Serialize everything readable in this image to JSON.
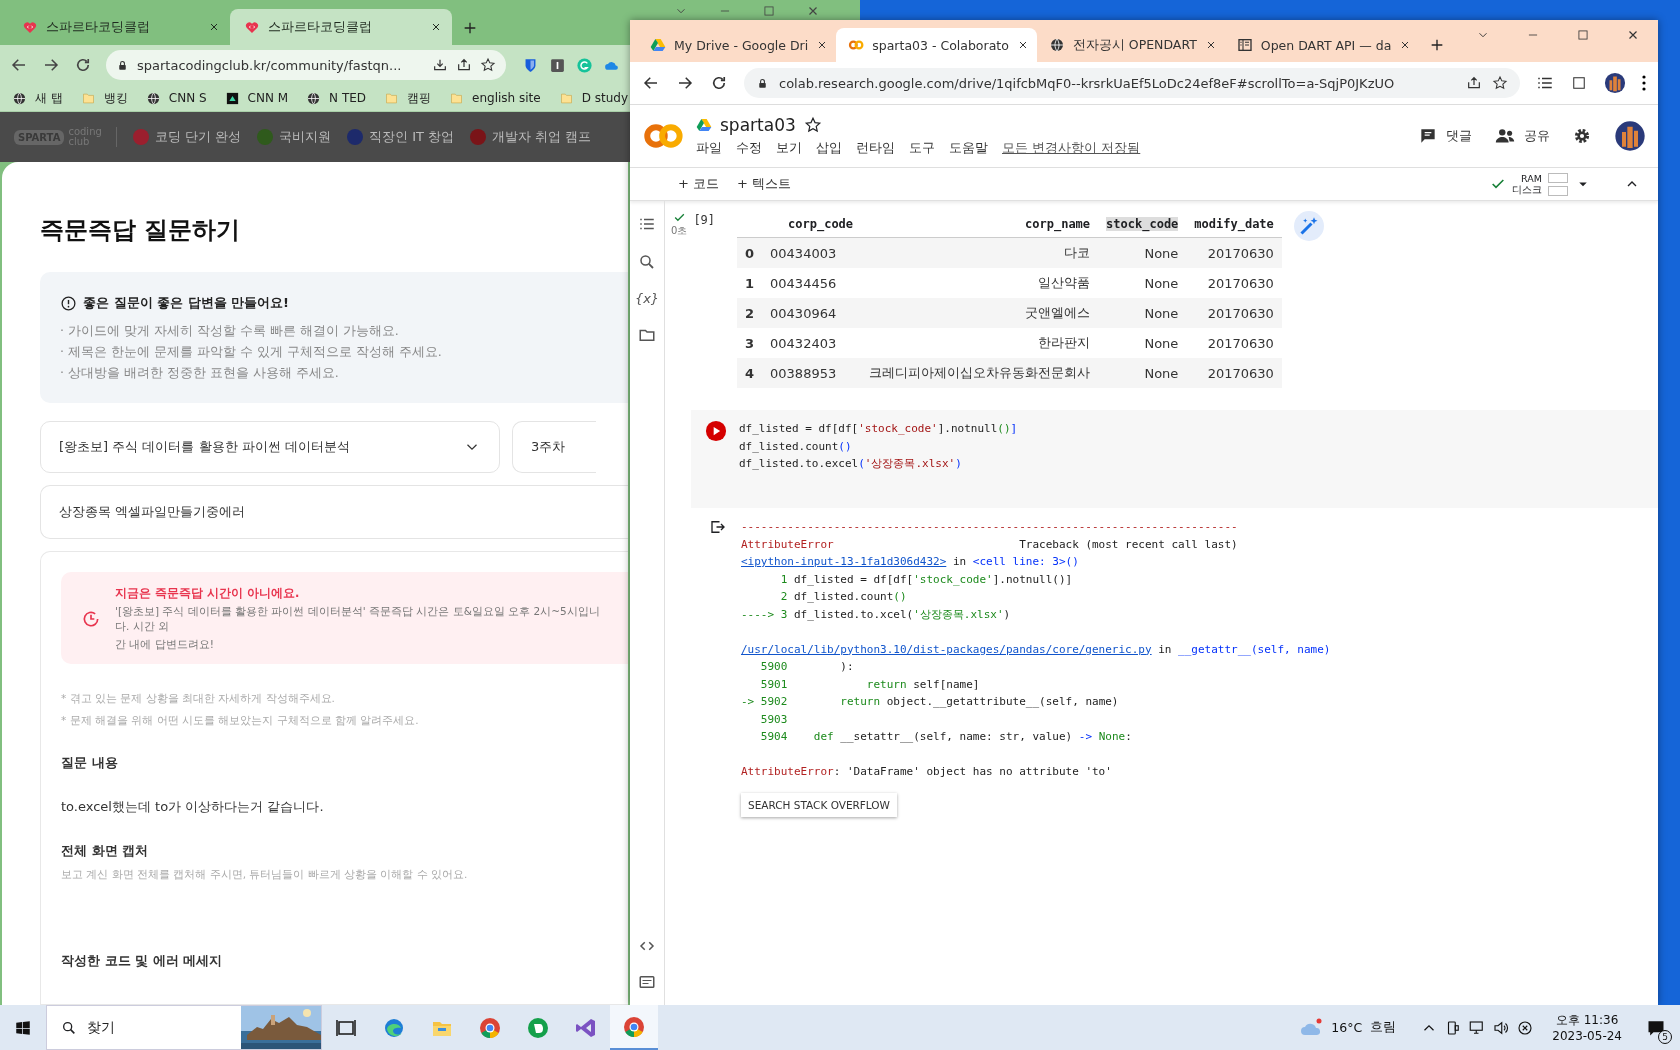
{
  "left_window": {
    "tabs": [
      {
        "title": "스파르타코딩클럽",
        "selected": false
      },
      {
        "title": "스파르타코딩클럽",
        "selected": true
      }
    ],
    "address": "spartacodingclub.kr/community/fastqn...",
    "bookmarks": [
      {
        "label": "새 탭",
        "kind": "globe"
      },
      {
        "label": "뱅킹",
        "kind": "folder"
      },
      {
        "label": "CNN S",
        "kind": "globe"
      },
      {
        "label": "CNN M",
        "kind": "app"
      },
      {
        "label": "N TED",
        "kind": "globe"
      },
      {
        "label": "캠핑",
        "kind": "folder"
      },
      {
        "label": "english site",
        "kind": "folder"
      },
      {
        "label": "D study",
        "kind": "folder"
      }
    ],
    "site_nav": {
      "logo_mark": "SPARTA",
      "logo_text": [
        "coding",
        "club"
      ],
      "items": [
        {
          "label": "코딩 단기 완성",
          "color": "#9b1f2e"
        },
        {
          "label": "국비지원",
          "color": "#2f5a1c"
        },
        {
          "label": "직장인 IT 창업",
          "color": "#1d2a6b"
        },
        {
          "label": "개발자 취업 캠프",
          "color": "#7a1418"
        }
      ]
    },
    "page": {
      "title": "즉문즉답 질문하기",
      "guide": {
        "heading": "좋은 질문이 좋은 답변을 만들어요!",
        "lines": [
          "· 가이드에 맞게 자세히 작성할 수록 빠른 해결이 가능해요.",
          "· 제목은 한눈에 문제를 파악할 수 있게 구체적으로 작성해 주세요.",
          "· 상대방을 배려한 정중한 표현을 사용해 주세요."
        ]
      },
      "course_select": "[왕초보] 주식 데이터를 활용한 파이썬 데이터분석",
      "week_select": "3주차",
      "title_field": "상장종목 엑셀파일만들기중에러",
      "notice": {
        "heading": "지금은 즉문즉답 시간이 아니에요.",
        "lines": [
          "'[왕초보] 주식 데이터를 활용한 파이썬 데이터분석' 즉문즉답 시간은 토&일요일 오후 2시~5시입니다. 시간 외",
          "간 내에 답변드려요!"
        ]
      },
      "hints": [
        "* 겪고 있는 문제 상황을 최대한 자세하게 작성해주세요.",
        "* 문제 해결을 위해 어떤 시도를 해보았는지 구체적으로 함께 알려주세요."
      ],
      "sections": [
        {
          "label": "질문 내용",
          "text": "to.excel했는데 to가 이상하다는거 같습니다."
        },
        {
          "label": "전체 화면 캡처",
          "hint": "보고 계신 화면 전체를 캡처해 주시면, 튜터님들이 빠르게 상황을 이해할 수 있어요."
        },
        {
          "label": "작성한 코드 및 에러 메세지"
        }
      ]
    }
  },
  "right_window": {
    "tabs": [
      {
        "title": "My Drive - Google Dri",
        "selected": false,
        "kind": "drive"
      },
      {
        "title": "sparta03 - Colaborato",
        "selected": true,
        "kind": "colab"
      },
      {
        "title": "전자공시 OPENDART",
        "selected": false,
        "kind": "globe"
      },
      {
        "title": "Open DART API — da",
        "selected": false,
        "kind": "book"
      }
    ],
    "address": "colab.research.google.com/drive/1qifcbMqF0--krsrkUaEf5LoDc24ef8eF#scrollTo=a-SqjP0JKzUO",
    "notebook": {
      "title": "sparta03",
      "menu": [
        "파일",
        "수정",
        "보기",
        "삽입",
        "런타임",
        "도구",
        "도움말"
      ],
      "saved": "모든 변경사항이 저장됨",
      "comment": "댓글",
      "share": "공유",
      "add_code": "+ 코드",
      "add_text": "+ 텍스트",
      "ram": "RAM",
      "disk": "디스크",
      "rail_variables": "{x}",
      "output_cell": {
        "count": "[9]",
        "duration": "0초",
        "done": true,
        "columns": [
          {
            "label": "corp_code",
            "highlighted": false
          },
          {
            "label": "corp_name",
            "highlighted": false
          },
          {
            "label": "stock_code",
            "highlighted": true
          },
          {
            "label": "modify_date",
            "highlighted": false
          }
        ],
        "rows": [
          {
            "index": "0",
            "cells": [
              "00434003",
              "다코",
              "None",
              "20170630"
            ]
          },
          {
            "index": "1",
            "cells": [
              "00434456",
              "일산약품",
              "None",
              "20170630"
            ]
          },
          {
            "index": "2",
            "cells": [
              "00430964",
              "굿앤엘에스",
              "None",
              "20170630"
            ]
          },
          {
            "index": "3",
            "cells": [
              "00432403",
              "한라판지",
              "None",
              "20170630"
            ]
          },
          {
            "index": "4",
            "cells": [
              "00388953",
              "크레디피아제이십오차유동화전문회사",
              "None",
              "20170630"
            ]
          }
        ]
      },
      "code_cell": {
        "errored": true,
        "lines": [
          [
            {
              "kind": "t",
              "text": "df_listed = df[df["
            },
            {
              "kind": "s",
              "text": "'stock_code'"
            },
            {
              "kind": "t",
              "text": "].notnull"
            },
            {
              "kind": "g",
              "text": "()"
            },
            {
              "kind": "b",
              "text": "]"
            }
          ],
          [
            {
              "kind": "t",
              "text": "df_listed.count"
            },
            {
              "kind": "b",
              "text": "()"
            }
          ],
          [
            {
              "kind": "t",
              "text": "df_listed.to.excel"
            },
            {
              "kind": "b",
              "text": "("
            },
            {
              "kind": "s",
              "text": "'상장종목.xlsx'"
            },
            {
              "kind": "b",
              "text": ")"
            }
          ]
        ]
      },
      "traceback": [
        [
          [
            {
              "kind": "r",
              "text": "---------------------------------------------------------------------------"
            }
          ],
          [
            {
              "kind": "r",
              "text": "AttributeError"
            },
            {
              "kind": "t",
              "text": "                            Traceback (most recent call last)"
            }
          ],
          [
            {
              "kind": "l",
              "text": "<ipython-input-13-1fa1d306d432>"
            },
            {
              "kind": "t",
              "text": " in "
            },
            {
              "kind": "b",
              "text": "<cell line: 3>()"
            }
          ],
          [
            {
              "kind": "g",
              "text": "      1 "
            },
            {
              "kind": "t",
              "text": "df_listed = df[df["
            },
            {
              "kind": "g",
              "text": "'stock_code'"
            },
            {
              "kind": "t",
              "text": "].notnull()]"
            }
          ],
          [
            {
              "kind": "g",
              "text": "      2 "
            },
            {
              "kind": "t",
              "text": "df_listed.count"
            },
            {
              "kind": "g",
              "text": "()"
            }
          ],
          [
            {
              "kind": "g",
              "text": "----> 3 "
            },
            {
              "kind": "t",
              "text": "df_listed.to.xcel("
            },
            {
              "kind": "g",
              "text": "'상장종목.xlsx'"
            },
            {
              "kind": "t",
              "text": ")"
            }
          ]
        ],
        [
          [
            {
              "kind": "l",
              "text": "/usr/local/lib/python3.10/dist-packages/pandas/core/generic.py"
            },
            {
              "kind": "t",
              "text": " in "
            },
            {
              "kind": "b",
              "text": "__getattr__(self, name)"
            }
          ],
          [
            {
              "kind": "g",
              "text": "   5900 "
            },
            {
              "kind": "t",
              "text": "       ):"
            }
          ],
          [
            {
              "kind": "g",
              "text": "   5901 "
            },
            {
              "kind": "g",
              "text": "           return "
            },
            {
              "kind": "t",
              "text": "self[name]"
            }
          ],
          [
            {
              "kind": "g",
              "text": "-> 5902 "
            },
            {
              "kind": "g",
              "text": "       return "
            },
            {
              "kind": "t",
              "text": "object.__getattribute__(self, name)"
            }
          ],
          [
            {
              "kind": "g",
              "text": "   5903"
            }
          ],
          [
            {
              "kind": "g",
              "text": "   5904 "
            },
            {
              "kind": "g",
              "text": "   def "
            },
            {
              "kind": "t",
              "text": "__setattr__(self, name: str, value) "
            },
            {
              "kind": "b",
              "text": "->"
            },
            {
              "kind": "g",
              "text": " None"
            },
            {
              "kind": "t",
              "text": ":"
            }
          ]
        ],
        [
          [
            {
              "kind": "r",
              "text": "AttributeError"
            },
            {
              "kind": "t",
              "text": ": 'DataFrame' object has no attribute 'to'"
            }
          ]
        ]
      ],
      "stack_overflow_button": "SEARCH STACK OVERFLOW"
    }
  },
  "taskbar": {
    "search_placeholder": "찾기",
    "apps": [
      {
        "kind": "taskview",
        "active": false
      },
      {
        "kind": "edge",
        "active": false
      },
      {
        "kind": "explorer",
        "active": false
      },
      {
        "kind": "chrome",
        "active": false
      },
      {
        "kind": "evernote",
        "active": false
      },
      {
        "kind": "vs",
        "active": false
      },
      {
        "kind": "chrome",
        "active": true
      }
    ],
    "temperature": "16°C",
    "weather": "흐림",
    "time": "오후 11:36",
    "date": "2023-05-24",
    "notifications": "5"
  }
}
